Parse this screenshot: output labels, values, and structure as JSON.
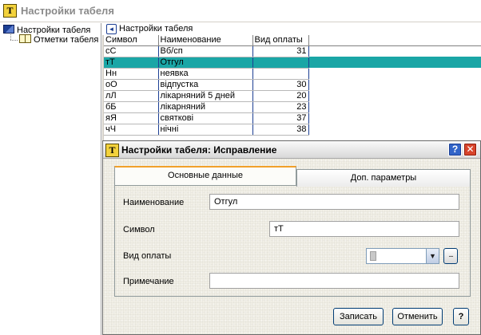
{
  "main_window": {
    "title": "Настройки табеля",
    "icon": "T"
  },
  "tree": {
    "items": [
      {
        "label": "Настройки табеля",
        "icon": "book-icon"
      },
      {
        "label": "Отметки табеля",
        "icon": "open-book-icon"
      }
    ]
  },
  "panel": {
    "title": "Настройки табеля",
    "back_icon": "◄"
  },
  "grid": {
    "columns": [
      "Символ",
      "Наименование",
      "Вид оплаты"
    ],
    "rows": [
      {
        "symbol": "сС",
        "name": "Вб/сп",
        "pay": "31",
        "selected": false
      },
      {
        "symbol": "тТ",
        "name": "Отгул",
        "pay": "",
        "selected": true
      },
      {
        "symbol": "Нн",
        "name": "неявка",
        "pay": "",
        "selected": false
      },
      {
        "symbol": "оО",
        "name": "відпустка",
        "pay": "30",
        "selected": false
      },
      {
        "symbol": "лЛ",
        "name": "лікарняний 5 дней",
        "pay": "20",
        "selected": false
      },
      {
        "symbol": "бБ",
        "name": "лікарняний",
        "pay": "23",
        "selected": false
      },
      {
        "symbol": "яЯ",
        "name": "святкові",
        "pay": "37",
        "selected": false
      },
      {
        "symbol": "чЧ",
        "name": "нічні",
        "pay": "38",
        "selected": false
      }
    ]
  },
  "dialog": {
    "title": "Настройки табеля: Исправление",
    "icon": "T",
    "help_icon": "?",
    "close_icon": "✕",
    "tabs": [
      {
        "label": "Основные данные",
        "active": true
      },
      {
        "label": "Доп. параметры",
        "active": false
      }
    ],
    "fields": {
      "name_label": "Наименование",
      "name_value": "Отгул",
      "symbol_label": "Символ",
      "symbol_value": "тТ",
      "pay_type_label": "Вид оплаты",
      "pay_type_value": "",
      "note_label": "Примечание",
      "note_value": ""
    },
    "dropdown_icon": "▼",
    "ellipsis": "...",
    "buttons": {
      "save": "Записать",
      "cancel": "Отменить",
      "help": "?"
    }
  },
  "colors": {
    "selection": "#1aa6a6",
    "grid_line": "#1c3f94",
    "tab_accent": "#f1a02a",
    "close_button": "#d8452c",
    "help_button": "#3264c8"
  }
}
